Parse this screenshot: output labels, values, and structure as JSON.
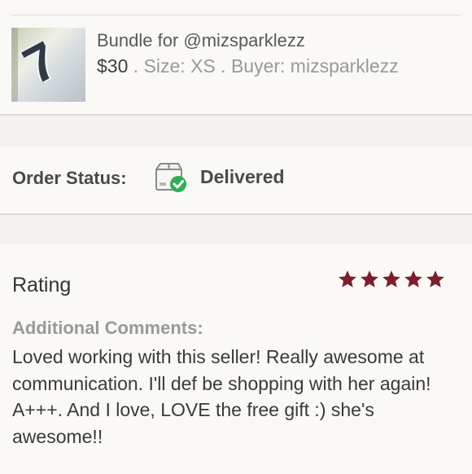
{
  "listing": {
    "bundle_title": "Bundle for @mizsparklezz",
    "price": "$30",
    "separator": " . ",
    "size": "Size: XS",
    "buyer": "Buyer: mizsparklezz",
    "thumbnail_number": "7"
  },
  "order": {
    "status_label": "Order Status:",
    "status_value": "Delivered",
    "status_icon": "delivered-box-check-icon",
    "check_color": "#2eae55"
  },
  "rating": {
    "title": "Rating",
    "stars": 5,
    "star_color": "#7b1f2c",
    "comments_label": "Additional Comments:",
    "comments": "Loved working with this seller! Really awesome at communication. I'll def be shopping with her again! A+++. And I love, LOVE the free gift :) she's awesome!!"
  }
}
